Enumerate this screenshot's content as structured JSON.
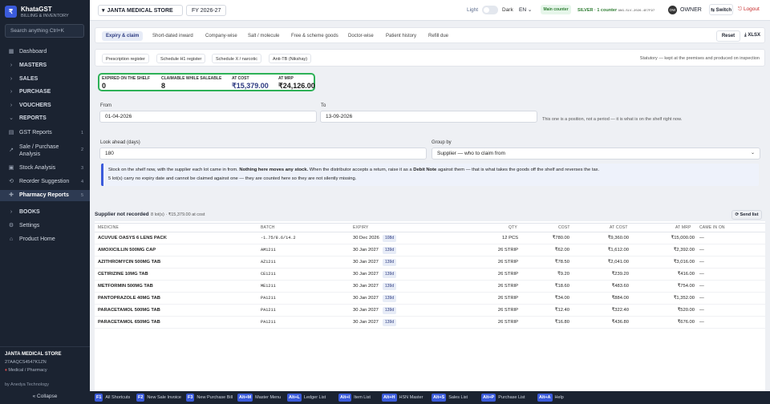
{
  "sidebar": {
    "logo_glyph": "₹",
    "brand": "KhataGST",
    "brand_sub": "BILLING & INVENTORY",
    "search_placeholder": "Search anything   Ctrl+K",
    "items": [
      {
        "label": "Dashboard",
        "icon": "grid-icon",
        "glyph": "▦",
        "count": ""
      },
      {
        "label": "MASTERS",
        "icon": "chevron-right-icon",
        "glyph": "›",
        "count": ""
      },
      {
        "label": "SALES",
        "icon": "chevron-right-icon",
        "glyph": "›",
        "count": ""
      },
      {
        "label": "PURCHASE",
        "icon": "chevron-right-icon",
        "glyph": "›",
        "count": ""
      },
      {
        "label": "VOUCHERS",
        "icon": "chevron-right-icon",
        "glyph": "›",
        "count": ""
      },
      {
        "label": "REPORTS",
        "icon": "chevron-down-icon",
        "glyph": "⌄",
        "count": ""
      },
      {
        "label": "GST Reports",
        "icon": "receipt-icon",
        "glyph": "▤",
        "count": "1"
      },
      {
        "label": "Sale / Purchase Analysis",
        "icon": "trend-icon",
        "glyph": "↗",
        "count": "2"
      },
      {
        "label": "Stock Analysis",
        "icon": "box-icon",
        "glyph": "▣",
        "count": "3"
      },
      {
        "label": "Reorder Suggestion",
        "icon": "cart-icon",
        "glyph": "⟲",
        "count": "4"
      },
      {
        "label": "Pharmacy Reports",
        "icon": "pill-icon",
        "glyph": "✚",
        "count": "5"
      },
      {
        "label": "BOOKS",
        "icon": "chevron-right-icon",
        "glyph": "›",
        "count": ""
      },
      {
        "label": "Settings",
        "icon": "gear-icon",
        "glyph": "⚙",
        "count": ""
      },
      {
        "label": "Product Home",
        "icon": "home-icon",
        "glyph": "⌂",
        "count": ""
      }
    ],
    "footer": {
      "store": "JANTA MEDICAL STORE",
      "gstin": "27AAQCS4547K1ZN",
      "type": "Medical / Pharmacy",
      "by": "by Anedya Technology",
      "collapse": "« Collapse"
    }
  },
  "topbar": {
    "store": "JANTA MEDICAL STORE",
    "store_caret": "▾",
    "fy": "FY 2026-27",
    "light": "Light",
    "dark": "Dark",
    "lang": "EN",
    "lang_caret": "⌄",
    "main_counter": "Main counter",
    "silver": "SILVER · 1 counter",
    "license": "ANG-SLV-2026-4E7F97",
    "owner_initials": "OW",
    "owner": "OWNER",
    "switch": "⇆ Switch",
    "logout": "⎋ Logout"
  },
  "tabs": [
    {
      "label": "Expiry & claim",
      "active": true
    },
    {
      "label": "Short-dated inward"
    },
    {
      "label": "Company-wise"
    },
    {
      "label": "Salt / molecule"
    },
    {
      "label": "Free & scheme goods"
    },
    {
      "label": "Doctor-wise"
    },
    {
      "label": "Patient history"
    },
    {
      "label": "Refill due"
    }
  ],
  "actions": {
    "reset": "Reset",
    "xls": "⤓ XLSX"
  },
  "registers": {
    "items": [
      "Prescription register",
      "Schedule H1 register",
      "Schedule X / narcotic",
      "Anti-TB (Nikshay)"
    ],
    "note": "Statutory — kept at the premises and produced on inspection"
  },
  "kpis": [
    {
      "label": "EXPIRED ON THE SHELF",
      "value": "0"
    },
    {
      "label": "CLAIMABLE WHILE SALEABLE",
      "value": "8"
    },
    {
      "label": "AT COST",
      "value": "₹15,379.00"
    },
    {
      "label": "AT MRP",
      "value": "₹24,126.00"
    }
  ],
  "filters": {
    "from_label": "From",
    "from_value": "01-04-2026",
    "to_label": "To",
    "to_value": "13-09-2026",
    "position_note": "This one is a position, not a period — it is what is on the shelf right now.",
    "lookahead_label": "Look ahead (days)",
    "lookahead_value": "180",
    "groupby_label": "Group by",
    "groupby_value": "Supplier — who to claim from",
    "groupby_caret": "⌄"
  },
  "info": {
    "l1_a": "Stock on the shelf now, with the supplier each lot came in from.",
    "l1_b": "Nothing here moves any stock.",
    "l1_c": "When the distributor accepts a return, raise it as a",
    "l1_d": "Debit Note",
    "l1_e": "against them — that is what takes the goods off the shelf and reverses the tax.",
    "l2": "5 lot(s) carry no expiry date and cannot be claimed against one — they are counted here so they are not silently missing."
  },
  "table": {
    "title": "Supplier not recorded",
    "subtitle": "8 lot(s) · ₹15,379.00 at cost",
    "send": "⟳ Send list",
    "headers": [
      "MEDICINE",
      "BATCH",
      "EXPIRY",
      "QTY",
      "COST",
      "AT COST",
      "AT MRP",
      "CAME IN ON"
    ],
    "rows": [
      {
        "medicine": "ACUVUE OASYS 6 LENS PACK",
        "batch": "-1.75/8.6/14.2",
        "expiry": "30 Dec 2026",
        "days": "108d",
        "qty": "12 PCS",
        "cost": "₹780.00",
        "at_cost": "₹9,360.00",
        "at_mrp": "₹15,000.00",
        "came": "—"
      },
      {
        "medicine": "AMOXICILLIN 500MG CAP",
        "batch": "AM1211",
        "expiry": "30 Jan 2027",
        "days": "139d",
        "qty": "26 STRIP",
        "cost": "₹62.00",
        "at_cost": "₹1,612.00",
        "at_mrp": "₹2,392.00",
        "came": "—"
      },
      {
        "medicine": "AZITHROMYCIN 500MG TAB",
        "batch": "AZ1211",
        "expiry": "30 Jan 2027",
        "days": "139d",
        "qty": "26 STRIP",
        "cost": "₹78.50",
        "at_cost": "₹2,041.00",
        "at_mrp": "₹3,016.00",
        "came": "—"
      },
      {
        "medicine": "CETIRIZINE 10MG TAB",
        "batch": "CE1211",
        "expiry": "30 Jan 2027",
        "days": "139d",
        "qty": "26 STRIP",
        "cost": "₹9.20",
        "at_cost": "₹239.20",
        "at_mrp": "₹416.00",
        "came": "—"
      },
      {
        "medicine": "METFORMIN 500MG TAB",
        "batch": "ME1211",
        "expiry": "30 Jan 2027",
        "days": "139d",
        "qty": "26 STRIP",
        "cost": "₹18.60",
        "at_cost": "₹483.60",
        "at_mrp": "₹754.00",
        "came": "—"
      },
      {
        "medicine": "PANTOPRAZOLE 40MG TAB",
        "batch": "PA1211",
        "expiry": "30 Jan 2027",
        "days": "139d",
        "qty": "26 STRIP",
        "cost": "₹34.00",
        "at_cost": "₹884.00",
        "at_mrp": "₹1,352.00",
        "came": "—"
      },
      {
        "medicine": "PARACETAMOL 500MG TAB",
        "batch": "PA1211",
        "expiry": "30 Jan 2027",
        "days": "139d",
        "qty": "26 STRIP",
        "cost": "₹12.40",
        "at_cost": "₹322.40",
        "at_mrp": "₹520.00",
        "came": "—"
      },
      {
        "medicine": "PARACETAMOL 650MG TAB",
        "batch": "PA1211",
        "expiry": "30 Jan 2027",
        "days": "139d",
        "qty": "26 STRIP",
        "cost": "₹16.80",
        "at_cost": "₹436.80",
        "at_mrp": "₹676.00",
        "came": "—"
      }
    ]
  },
  "shortcuts": [
    {
      "key": "F1",
      "label": "All Shortcuts"
    },
    {
      "key": "F2",
      "label": "New Sale Invoice"
    },
    {
      "key": "F3",
      "label": "New Purchase Bill"
    },
    {
      "key": "Alt+M",
      "label": "Master Menu"
    },
    {
      "key": "Alt+L",
      "label": "Ledger List"
    },
    {
      "key": "Alt+I",
      "label": "Item List"
    },
    {
      "key": "Alt+H",
      "label": "HSN Master"
    },
    {
      "key": "Alt+S",
      "label": "Sales List"
    },
    {
      "key": "Alt+P",
      "label": "Purchase List"
    },
    {
      "key": "Alt+A",
      "label": "Help"
    }
  ]
}
